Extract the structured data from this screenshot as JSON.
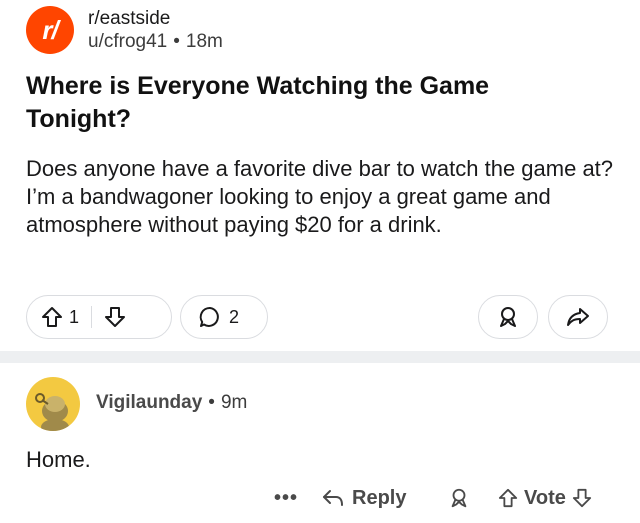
{
  "post": {
    "logo_text": "r/",
    "subreddit": "r/eastside",
    "author": "u/cfrog41",
    "separator": "•",
    "age": "18m",
    "title": "Where is Everyone Watching the Game Tonight?",
    "body": "Does anyone have a favorite dive bar to watch the game at? I’m a bandwagoner looking to enjoy a great game and atmosphere without paying $20 for a drink.",
    "upvotes": "1",
    "comments": "2",
    "accent_color": "#ff4500"
  },
  "icons": {
    "upvote": "upvote-arrow-icon",
    "downvote": "downvote-arrow-icon",
    "comment": "comment-bubble-icon",
    "award": "award-icon",
    "share": "share-arrow-icon",
    "more": "more-dots-icon",
    "reply": "reply-arrow-icon"
  },
  "comment": {
    "author": "Vigilaunday",
    "separator": "•",
    "age": "9m",
    "body": "Home.",
    "more_label": "•••",
    "reply_label": "Reply",
    "vote_label": "Vote"
  }
}
